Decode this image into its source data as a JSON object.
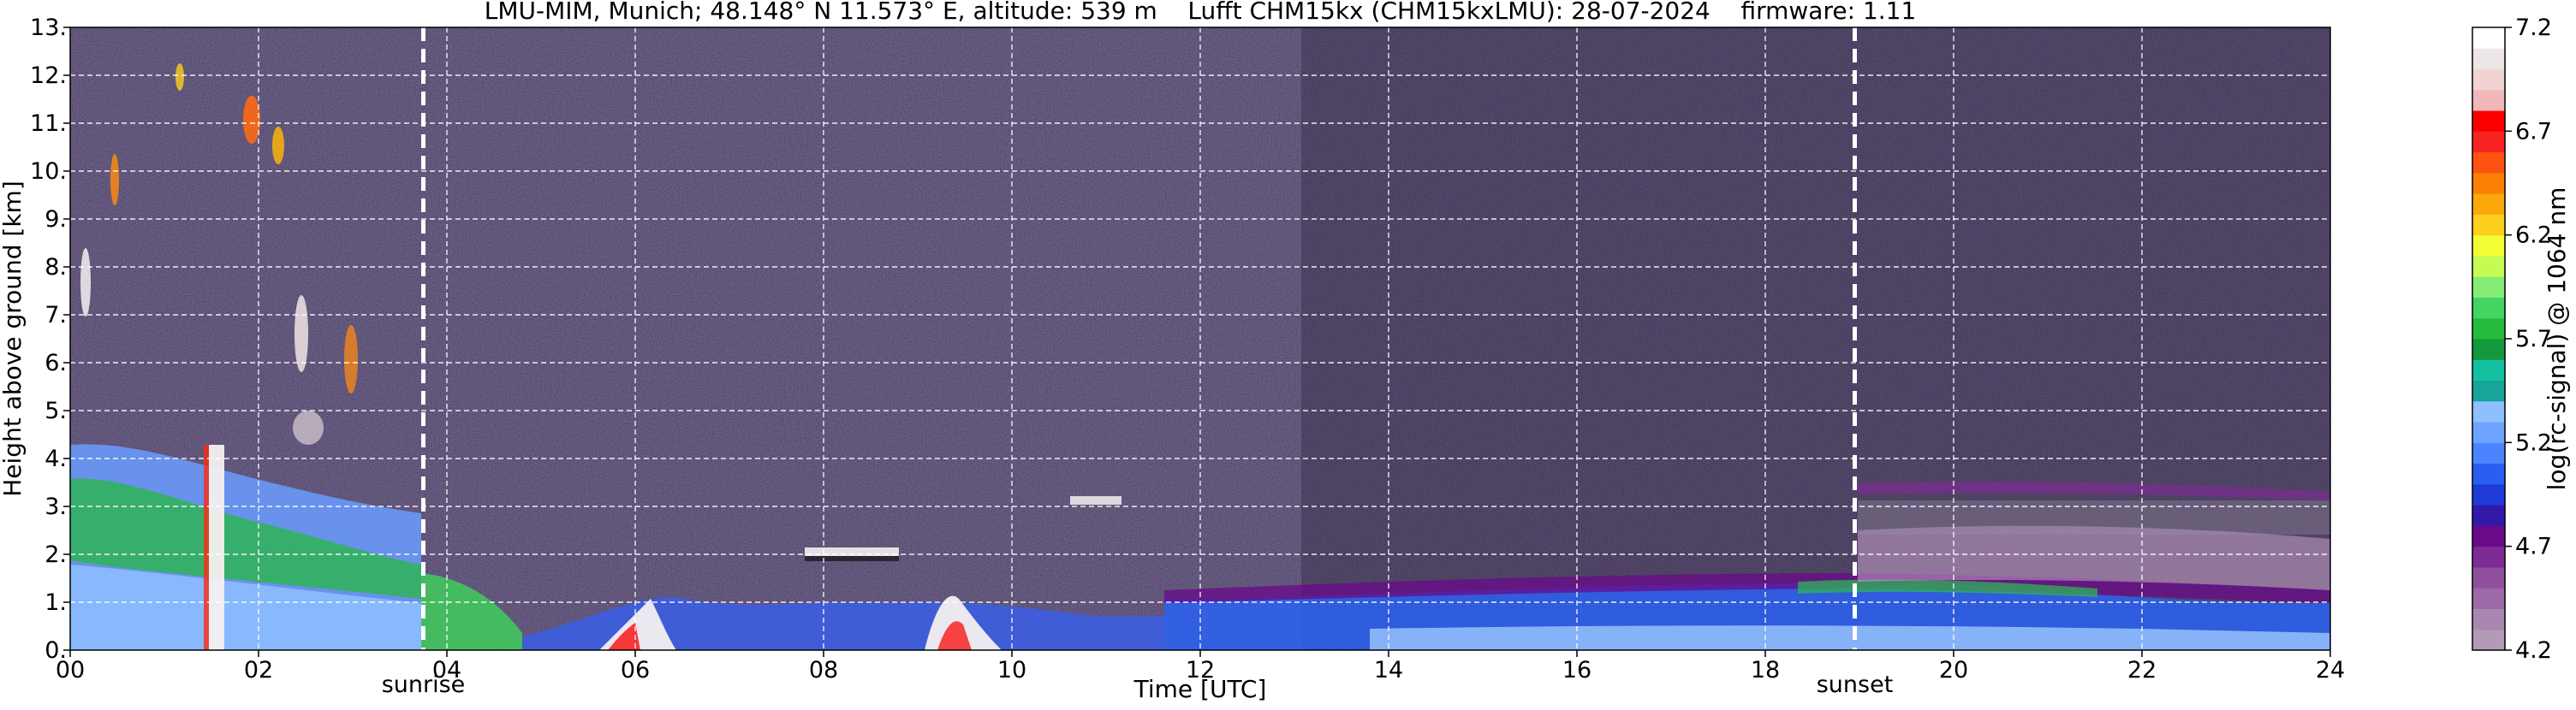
{
  "chart_data": {
    "type": "heatmap",
    "title": "LMU-MIM, Munich; 48.148° N 11.573° E, altitude: 539 m    Lufft CHM15kx (CHM15kxLMU): 28-07-2024    firmware: 1.11",
    "xlabel": "Time [UTC]",
    "ylabel": "Height above ground [km]",
    "colorbar_label": "log(rc-signal) @ 1064 nm",
    "xlim": [
      0,
      24
    ],
    "ylim": [
      0,
      13
    ],
    "x_ticks": [
      0,
      2,
      4,
      6,
      8,
      10,
      12,
      14,
      16,
      18,
      20,
      22,
      24
    ],
    "x_tick_labels": [
      "00",
      "02",
      "04",
      "06",
      "08",
      "10",
      "12",
      "14",
      "16",
      "18",
      "20",
      "22",
      "24"
    ],
    "y_ticks": [
      0,
      1,
      2,
      3,
      4,
      5,
      6,
      7,
      8,
      9,
      10,
      11,
      12,
      13
    ],
    "y_tick_labels": [
      "0.",
      "1.",
      "2.",
      "3.",
      "4.",
      "5.",
      "6.",
      "7.",
      "8.",
      "9.",
      "10.",
      "11.",
      "12.",
      "13."
    ],
    "grid": true,
    "colorbar_range": [
      4.2,
      7.2
    ],
    "colorbar_ticks": [
      4.2,
      4.7,
      5.2,
      5.7,
      6.2,
      6.7,
      7.2
    ],
    "colorbar_tick_labels": [
      "4.2",
      "4.7",
      "5.2",
      "5.7",
      "6.2",
      "6.7",
      "7.2"
    ],
    "colorbar_colors": [
      "#b39bb8",
      "#a888b0",
      "#9c6aa6",
      "#8e4f9e",
      "#7c2c92",
      "#6a0a8a",
      "#3418a8",
      "#1e3ad8",
      "#2a5ef2",
      "#4a84ff",
      "#6ea4ff",
      "#8ec0ff",
      "#17a49a",
      "#14c0a0",
      "#14983c",
      "#24bc3c",
      "#44d464",
      "#84ec74",
      "#c4fc54",
      "#f4fc34",
      "#fcd01c",
      "#fca80c",
      "#fc8004",
      "#fc5410",
      "#f82424",
      "#fc0000",
      "#f0b8b8",
      "#f0d4d4",
      "#ece6e6",
      "#ffffff"
    ],
    "events": [
      {
        "label": "sunrise",
        "time": 3.75
      },
      {
        "label": "sunset",
        "time": 18.95
      }
    ]
  }
}
